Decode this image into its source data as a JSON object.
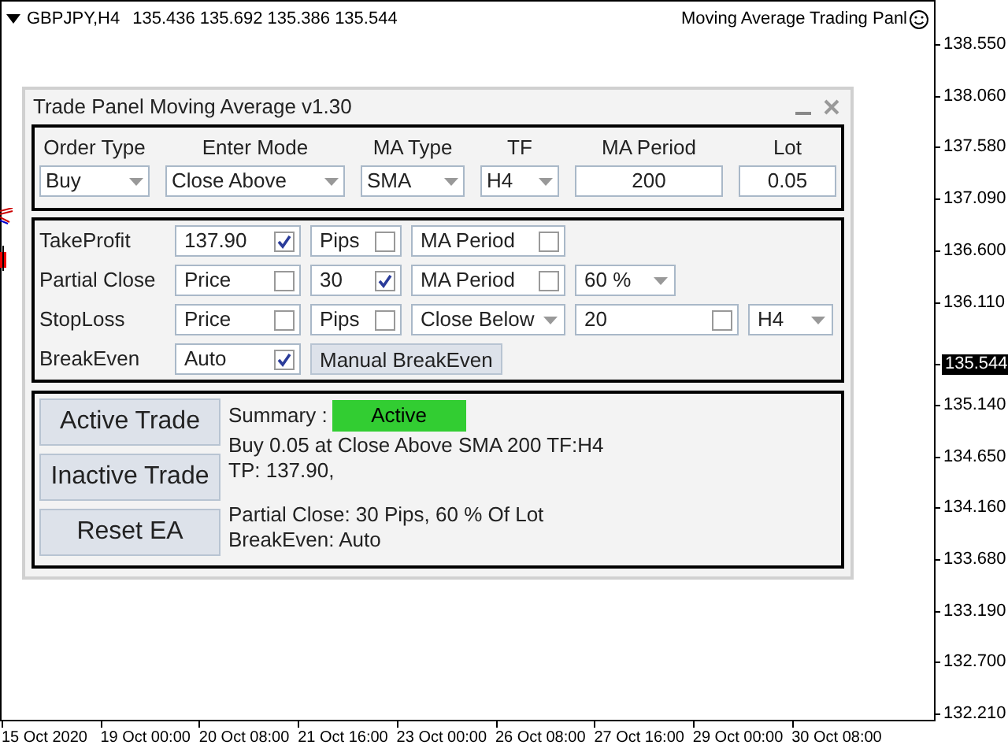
{
  "chart": {
    "symbol": "GBPJPY,H4",
    "ohlc": "135.436 135.692 135.386 135.544",
    "indicator_label": "Moving Average Trading Panl",
    "price_axis": [
      "138.550",
      "138.060",
      "137.580",
      "137.090",
      "136.600",
      "136.110",
      "135.140",
      "134.650",
      "134.160",
      "133.680",
      "133.190",
      "132.700",
      "132.210"
    ],
    "current_price": "135.544",
    "time_axis": [
      "15 Oct 2020",
      "19 Oct 00:00",
      "20 Oct 08:00",
      "21 Oct 16:00",
      "23 Oct 00:00",
      "26 Oct 08:00",
      "27 Oct 16:00",
      "29 Oct 00:00",
      "30 Oct 08:00"
    ]
  },
  "panel": {
    "title": "Trade Panel Moving Average v1.30",
    "order_settings": [
      {
        "label": "Order Type",
        "kind": "dropdown",
        "value": "Buy"
      },
      {
        "label": "Enter Mode",
        "kind": "dropdown",
        "value": "Close Above"
      },
      {
        "label": "MA Type",
        "kind": "dropdown",
        "value": "SMA"
      },
      {
        "label": "TF",
        "kind": "dropdown",
        "value": "H4"
      },
      {
        "label": "MA Period",
        "kind": "input",
        "value": "200"
      },
      {
        "label": "Lot",
        "kind": "input",
        "value": "0.05"
      }
    ],
    "rules": [
      {
        "label": "TakeProfit",
        "controls": [
          {
            "kind": "check",
            "value": "137.90",
            "checked": true
          },
          {
            "kind": "check",
            "value": "Pips",
            "checked": false
          },
          {
            "kind": "check",
            "value": "MA Period",
            "checked": false
          }
        ]
      },
      {
        "label": "Partial Close",
        "controls": [
          {
            "kind": "check",
            "value": "Price",
            "checked": false
          },
          {
            "kind": "check",
            "value": "30",
            "checked": true
          },
          {
            "kind": "check",
            "value": "MA Period",
            "checked": false
          },
          {
            "kind": "dropdown",
            "value": "60 %"
          }
        ]
      },
      {
        "label": "StopLoss",
        "controls": [
          {
            "kind": "check",
            "value": "Price",
            "checked": false
          },
          {
            "kind": "check",
            "value": "Pips",
            "checked": false
          },
          {
            "kind": "dropdown",
            "value": "Close Below"
          },
          {
            "kind": "check",
            "value": "20",
            "checked": false
          },
          {
            "kind": "dropdown",
            "value": "H4"
          }
        ]
      },
      {
        "label": "BreakEven",
        "controls": [
          {
            "kind": "check",
            "value": "Auto",
            "checked": true
          },
          {
            "kind": "button",
            "value": "Manual BreakEven"
          }
        ]
      }
    ],
    "actions": [
      "Active Trade",
      "Inactive Trade",
      "Reset EA"
    ],
    "summary_label": "Summary :",
    "status": "Active",
    "summary_lines": [
      "Buy 0.05 at Close Above SMA 200 TF:H4",
      "TP: 137.90,"
    ],
    "summary_details": [
      "Partial Close: 30 Pips, 60 % Of Lot",
      "BreakEven: Auto"
    ]
  }
}
